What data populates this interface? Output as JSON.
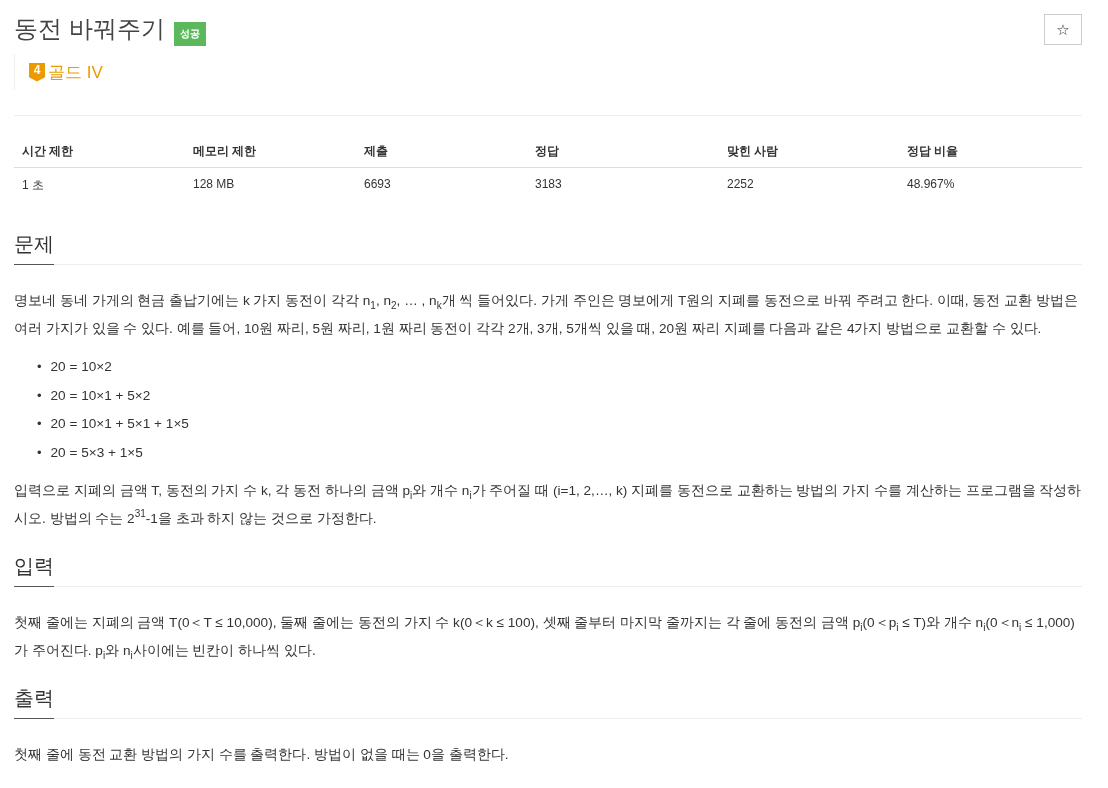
{
  "title": "동전 바꿔주기",
  "result_badge": {
    "text": "성공",
    "kind": "success"
  },
  "star_button": {
    "label": "☆"
  },
  "tier": {
    "kind": "gold",
    "level": "4",
    "name": "골드 IV"
  },
  "stats": {
    "columns": [
      "시간 제한",
      "메모리 제한",
      "제출",
      "정답",
      "맞힌 사람",
      "정답 비율"
    ],
    "rows": [
      [
        "1 초",
        "128 MB",
        "6693",
        "3183",
        "2252",
        "48.967%"
      ]
    ]
  },
  "sections": [
    {
      "heading": "문제",
      "blocks": [
        {
          "kind": "paragraph",
          "text": "명보네 동네 가게의 현금 출납기에는 k 가지 동전이 각각 n$_{1}$, n$_{2}$, … , n$_{k}$개 씩 들어있다. 가게 주인은 명보에게 T원의 지폐를 동전으로 바꿔 주려고 한다. 이때, 동전 교환 방법은 여러 가지가 있을 수 있다. 예를 들어, 10원 짜리, 5원 짜리, 1원 짜리 동전이 각각 2개, 3개, 5개씩 있을 때, 20원 짜리 지폐를 다음과 같은 4가지 방법으로 교환할 수 있다."
        },
        {
          "kind": "list",
          "items": [
            {
              "marker": "•",
              "text": "20 = 10×2"
            },
            {
              "marker": "•",
              "text": "20 = 10×1 + 5×2"
            },
            {
              "marker": "•",
              "text": "20 = 10×1 + 5×1 + 1×5"
            },
            {
              "marker": "•",
              "text": "20 = 5×3 + 1×5"
            }
          ]
        },
        {
          "kind": "paragraph",
          "text": "입력으로 지폐의 금액 T, 동전의 가지 수 k, 각 동전 하나의 금액 p$_{i}$와 개수 n$_{i}$가 주어질 때 (i=1, 2,…, k) 지폐를 동전으로 교환하는 방법의 가지 수를 계산하는 프로그램을 작성하시오. 방법의 수는 2$^{31}$-1을 초과 하지 않는 것으로 가정한다."
        }
      ]
    },
    {
      "heading": "입력",
      "blocks": [
        {
          "kind": "paragraph",
          "text": "첫째 줄에는 지폐의 금액 T(0＜T ≤ 10,000), 둘째 줄에는 동전의 가지 수 k(0＜k ≤ 100), 셋째 줄부터 마지막 줄까지는 각 줄에 동전의 금액 p$_{i}$(0＜p$_{i}$ ≤ T)와 개수 n$_{i}$(0＜n$_{i}$ ≤ 1,000)가 주어진다. p$_{i}$와 n$_{i}$사이에는 빈칸이 하나씩 있다."
        }
      ]
    },
    {
      "heading": "출력",
      "blocks": [
        {
          "kind": "paragraph",
          "text": "첫째 줄에 동전 교환 방법의 가지 수를 출력한다. 방법이 없을 때는 0을 출력한다."
        }
      ]
    }
  ]
}
